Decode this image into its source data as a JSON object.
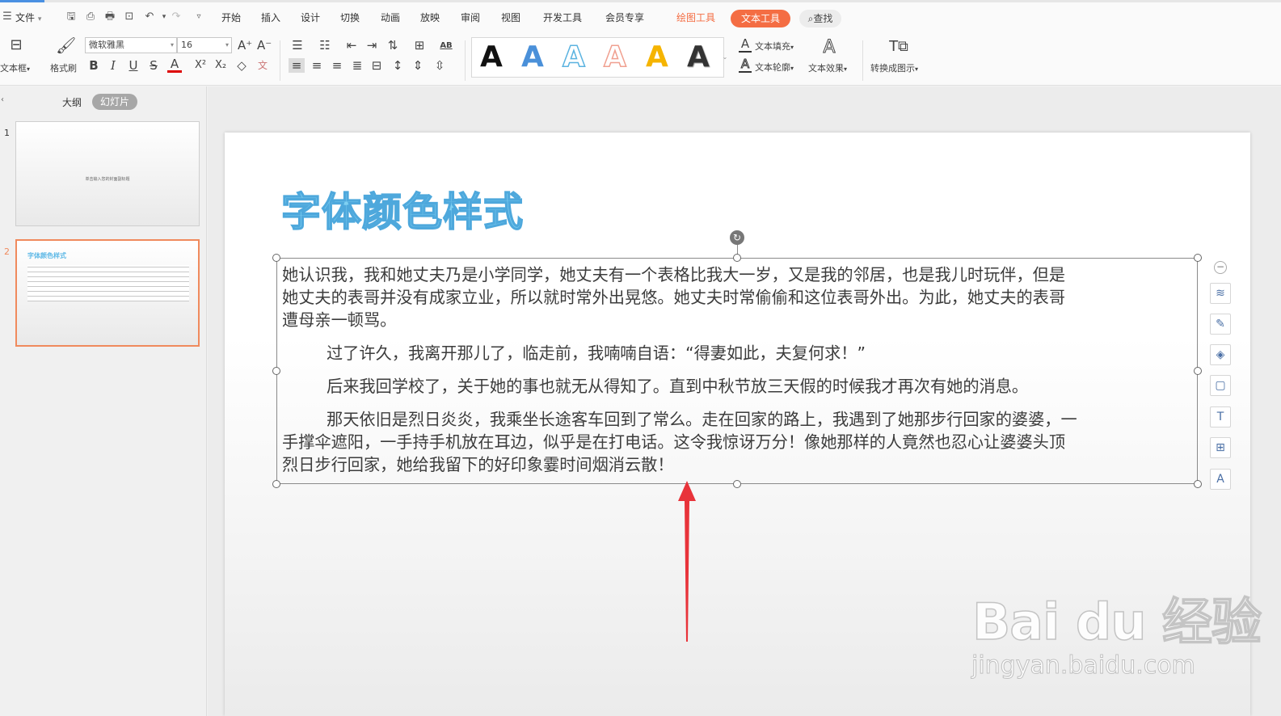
{
  "menubar": {
    "file_label": "文件",
    "tabs": [
      "开始",
      "插入",
      "设计",
      "切换",
      "动画",
      "放映",
      "审阅",
      "视图",
      "开发工具",
      "会员专享"
    ],
    "drawing_tools": "绘图工具",
    "text_tools": "文本工具",
    "search_label": "查找"
  },
  "ribbon": {
    "textbox_label": "文本框",
    "format_painter_label": "格式刷",
    "font_name": "微软雅黑",
    "font_size": "16",
    "text_fill_label": "文本填充",
    "text_outline_label": "文本轮廓",
    "text_effects_label": "文本效果",
    "convert_label": "转换成图示",
    "gallery_glyph": "A",
    "gallery_colors": [
      "#111111",
      "#4a90d9",
      "#5bb3e0",
      "#f0a090",
      "#f5b400",
      "#333333"
    ]
  },
  "panel": {
    "tab_outline": "大纲",
    "tab_slides": "幻灯片",
    "slide1_num": "1",
    "slide1_text": "单击输入您的封面副标题",
    "slide2_num": "2",
    "slide2_title": "字体颜色样式"
  },
  "slide": {
    "title": "字体颜色样式",
    "title_color": "#5cb8e6",
    "paragraphs": [
      [
        "她认识我，我和她丈夫乃是小学同学，她丈夫有一个表格比我大一岁，又是我的邻居，也是我儿时玩伴，但是",
        "她丈夫的表哥并没有成家立业，所以就时常外出晃悠。她丈夫时常偷偷和这位表哥外出。为此，她丈夫的表哥",
        "遭母亲一顿骂。"
      ],
      [
        "过了许久，我离开那儿了，临走前，我喃喃自语：“得妻如此，夫复何求！”"
      ],
      [
        "后来我回学校了，关于她的事也就无从得知了。直到中秋节放三天假的时候我才再次有她的消息。"
      ],
      [
        "那天依旧是烈日炎炎，我乘坐长途客车回到了常么。走在回家的路上，我遇到了她那步行回家的婆婆，一",
        "手撑伞遮阳，一手持手机放在耳边，似乎是在打电话。这令我惊讶万分！像她那样的人竟然也忍心让婆婆头顶",
        "烈日步行回家，她给我留下的好印象霎时间烟消云散！"
      ]
    ]
  },
  "colors": {
    "accent_orange": "#f46d43",
    "arrow_red": "#e8333a",
    "selected_thumb": "#f08a5d"
  },
  "watermark": {
    "logo": "Bai du 经验",
    "url": "jingyan.baidu.com"
  }
}
